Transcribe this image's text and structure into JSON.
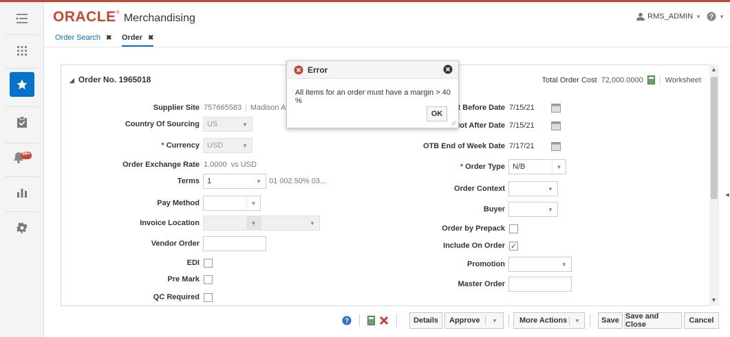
{
  "header": {
    "logo_text": "ORACLE",
    "app_name": "Merchandising",
    "user": "RMS_ADMIN",
    "brand_color": "#c74634"
  },
  "rail": {
    "notification_badge": "99+"
  },
  "tabs": [
    {
      "label": "Order Search"
    },
    {
      "label": "Order"
    }
  ],
  "panel": {
    "title": "Order No. 1965018",
    "total_label": "Total Order Cost",
    "total_value": "72,000.0000",
    "status": "Worksheet"
  },
  "form_left": {
    "supplier_site_label": "Supplier Site",
    "supplier_site_value": "757665583",
    "supplier_site_name": "Madison Aven",
    "country_label": "Country Of Sourcing",
    "country_value": "US",
    "currency_label": "Currency",
    "currency_value": "USD",
    "exchange_label": "Order Exchange Rate",
    "exchange_value": "1.0000",
    "exchange_suffix": "vs USD",
    "terms_label": "Terms",
    "terms_value": "1",
    "terms_desc": "01 002.50% 03...",
    "pay_method_label": "Pay Method",
    "invoice_location_label": "Invoice Location",
    "vendor_order_label": "Vendor Order",
    "edi_label": "EDI",
    "pre_mark_label": "Pre Mark",
    "qc_required_label": "QC Required"
  },
  "form_right": {
    "not_before_label": "ot Before Date",
    "not_before_value": "7/15/21",
    "not_after_label": "Not After Date",
    "not_after_value": "7/15/21",
    "otb_label": "OTB End of Week Date",
    "otb_value": "7/17/21",
    "order_type_label": "Order Type",
    "order_type_value": "N/B",
    "order_context_label": "Order Context",
    "buyer_label": "Buyer",
    "order_by_prepack_label": "Order by Prepack",
    "include_on_order_label": "Include On Order",
    "include_on_order_checked": true,
    "promotion_label": "Promotion",
    "master_order_label": "Master Order"
  },
  "dialog": {
    "title": "Error",
    "message": "All items for an order must have a margin > 40 %",
    "ok_label": "OK"
  },
  "footer": {
    "details_label": "Details",
    "approve_label": "Approve",
    "more_actions_label": "More Actions",
    "save_label": "Save",
    "save_close_label": "Save and Close",
    "cancel_label": "Cancel"
  },
  "icons": {
    "rail": [
      "menu-icon",
      "grid-icon",
      "star-icon",
      "clipboard-check-icon",
      "bell-icon",
      "bar-chart-icon",
      "gear-icon"
    ],
    "header": [
      "user-icon",
      "help-icon"
    ]
  }
}
